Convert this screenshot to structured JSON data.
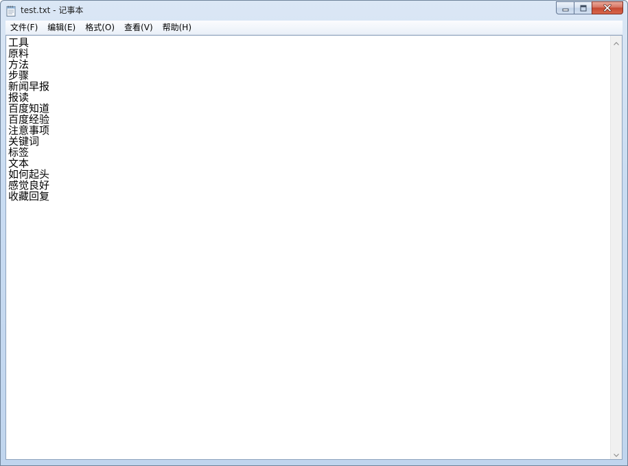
{
  "window": {
    "title": "test.txt - 记事本",
    "icon": "notepad-icon"
  },
  "caption": {
    "minimize_icon": "minimize-icon",
    "maximize_icon": "maximize-icon",
    "close_icon": "close-icon"
  },
  "menu": {
    "items": [
      {
        "label": "文件(F)"
      },
      {
        "label": "编辑(E)"
      },
      {
        "label": "格式(O)"
      },
      {
        "label": "查看(V)"
      },
      {
        "label": "帮助(H)"
      }
    ]
  },
  "document": {
    "lines": [
      "工具",
      "原料",
      "方法",
      "步骤",
      "新闻早报",
      "报读",
      "百度知道",
      "百度经验",
      "注意事项",
      "关键词",
      "标签",
      "文本",
      "如何起头",
      "感觉良好",
      "收藏回复"
    ]
  },
  "scrollbar": {
    "up_icon": "scroll-up-arrow-icon",
    "down_icon": "scroll-down-arrow-icon"
  },
  "colors": {
    "titlebar": "#c9dcf2",
    "close_button": "#c44a33",
    "editor_background": "#ffffff"
  }
}
